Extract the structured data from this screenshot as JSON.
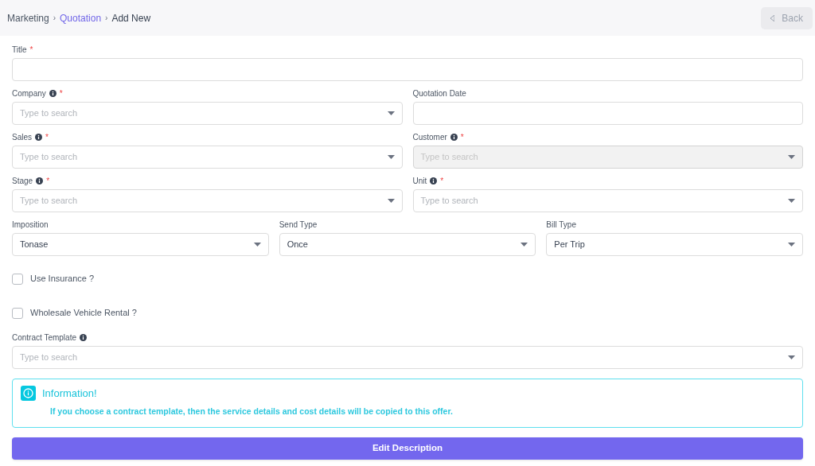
{
  "breadcrumb": [
    {
      "label": "Marketing",
      "kind": "text"
    },
    {
      "label": "Quotation",
      "kind": "link"
    },
    {
      "label": "Add New",
      "kind": "current"
    }
  ],
  "breadcrumb_separator": "›",
  "back_button": {
    "label": "Back",
    "disabled": true
  },
  "rows": [
    [
      {
        "label": "Title",
        "info": false,
        "required_mark": "*",
        "kind": "text",
        "disabled": false
      }
    ],
    [
      {
        "label": "Company",
        "info": true,
        "required_mark": "*",
        "kind": "select",
        "placeholder": "Type to search",
        "disabled": false
      },
      {
        "label": "Quotation Date",
        "info": false,
        "kind": "text",
        "disabled": false
      }
    ],
    [
      {
        "label": "Sales",
        "info": true,
        "required_mark": "*",
        "kind": "select",
        "placeholder": "Type to search",
        "disabled": false
      },
      {
        "label": "Customer",
        "info": true,
        "required_mark": "*",
        "kind": "select",
        "placeholder": "Type to search",
        "disabled": true
      }
    ],
    [
      {
        "label": "Stage",
        "info": true,
        "required_mark": "*",
        "kind": "select",
        "placeholder": "Type to search",
        "disabled": false
      },
      {
        "label": "Unit",
        "info": true,
        "required_mark": "*",
        "kind": "select",
        "placeholder": "Type to search",
        "disabled": false
      }
    ],
    [
      {
        "label": "Imposition",
        "info": false,
        "kind": "select",
        "value": "Tonase",
        "disabled": false
      },
      {
        "label": "Send Type",
        "info": false,
        "kind": "select",
        "value": "Once",
        "disabled": false
      },
      {
        "label": "Bill Type",
        "info": false,
        "kind": "select",
        "value": "Per Trip",
        "disabled": false
      }
    ]
  ],
  "checkboxes": [
    {
      "label": "Use Insurance ?",
      "checked": false
    },
    {
      "label": "Wholesale Vehicle Rental ?",
      "checked": false
    }
  ],
  "contract_template": {
    "label": "Contract Template",
    "info": true,
    "kind": "select",
    "placeholder": "Type to search",
    "disabled": false
  },
  "information": {
    "title": "Information!",
    "message": "If you choose a contract template, then the service details and cost details will be copied to this offer."
  },
  "edit_button": {
    "label": "Edit Description"
  }
}
